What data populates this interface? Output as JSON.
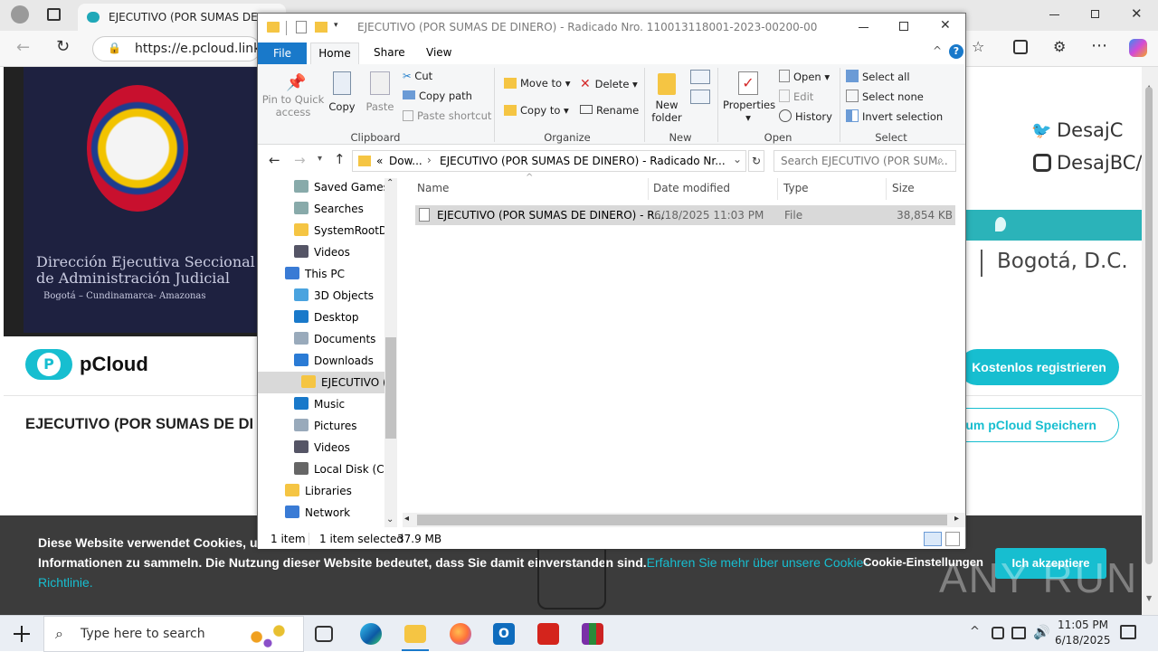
{
  "browser": {
    "tab_title": "EJECUTIVO (POR SUMAS DE DINER",
    "url": "https://e.pcloud.link/p"
  },
  "webpage": {
    "banner_line1": "Dirección Ejecutiva Seccional",
    "banner_line2": "de Administración Judicial",
    "banner_line3": "Bogotá – Cundinamarca- Amazonas",
    "twitter": "DesajC",
    "instagram": "DesajBC/",
    "city": "Bogotá, D.C.",
    "logo_text": "pCloud",
    "register_button": "Kostenlos registrieren",
    "save_button": "um pCloud Speichern",
    "file_title": "EJECUTIVO (POR SUMAS DE DI",
    "cookie_line1": "Diese Website verwendet Cookies, um I",
    "cookie_line2": "Informationen zu sammeln. Die Nutzung dieser Website bedeutet, dass Sie damit einverstanden sind.",
    "cookie_link": "Erfahren Sie mehr über unsere Cookie-",
    "cookie_link2": "Richtlinie.",
    "cookie_settings": "Cookie-Einstellungen",
    "cookie_accept": "Ich akzeptiere",
    "watermark": "ANY RUN"
  },
  "explorer": {
    "title": "EJECUTIVO (POR SUMAS DE DINERO) - Radicado Nro. 110013118001-2023-00200-00",
    "tabs": [
      "File",
      "Home",
      "Share",
      "View"
    ],
    "clipboard": {
      "pin": "Pin to Quick access",
      "pin1": "Pin to Quick",
      "pin2": "access",
      "copy": "Copy",
      "paste": "Paste",
      "cut": "Cut",
      "copy_path": "Copy path",
      "paste_shortcut": "Paste shortcut",
      "label": "Clipboard"
    },
    "organize": {
      "move_to": "Move to",
      "copy_to": "Copy to",
      "delete": "Delete",
      "rename": "Rename",
      "label": "Organize"
    },
    "new": {
      "new_folder1": "New",
      "new_folder2": "folder",
      "label": "New"
    },
    "open": {
      "properties": "Properties",
      "open": "Open",
      "edit": "Edit",
      "history": "History",
      "label": "Open"
    },
    "select": {
      "select_all": "Select all",
      "select_none": "Select none",
      "invert": "Invert selection",
      "label": "Select"
    },
    "breadcrumb": {
      "overflow": "«",
      "part1": "Dow...",
      "part2": "EJECUTIVO (POR SUMAS DE DINERO) - Radicado Nr..."
    },
    "search_placeholder": "Search EJECUTIVO (POR SUM...",
    "tree": [
      "Saved Games",
      "Searches",
      "SystemRootDo",
      "Videos",
      "This PC",
      "3D Objects",
      "Desktop",
      "Documents",
      "Downloads",
      "EJECUTIVO (P",
      "Music",
      "Pictures",
      "Videos",
      "Local Disk (C:)",
      "Libraries",
      "Network"
    ],
    "columns": [
      "Name",
      "Date modified",
      "Type",
      "Size"
    ],
    "file": {
      "name": "EJECUTIVO (POR SUMAS DE DINERO) - R...",
      "date": "6/18/2025 11:03 PM",
      "type": "File",
      "size": "38,854 KB"
    },
    "status": {
      "items": "1 item",
      "selected": "1 item selected",
      "size": "37.9 MB"
    }
  },
  "taskbar": {
    "search_placeholder": "Type here to search",
    "time": "11:05 PM",
    "date": "6/18/2025"
  }
}
